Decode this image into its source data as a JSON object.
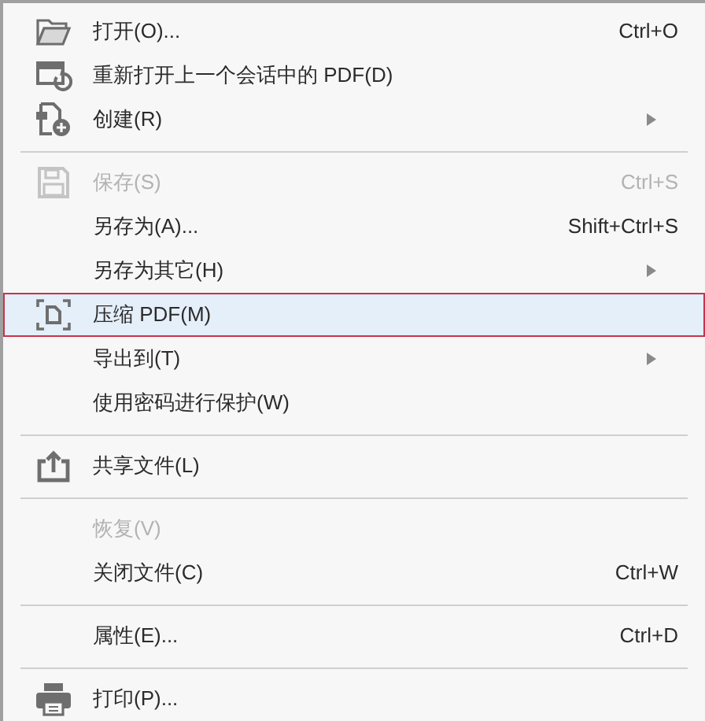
{
  "menu": [
    {
      "kind": "folder",
      "label": "打开(O)...",
      "shortcut": "Ctrl+O",
      "submenu": false,
      "disabled": false,
      "selected": false
    },
    {
      "kind": "reopen",
      "label": "重新打开上一个会话中的 PDF(D)",
      "submenu": false,
      "disabled": false,
      "selected": false
    },
    {
      "kind": "create",
      "label": "创建(R)",
      "submenu": true,
      "disabled": false,
      "selected": false
    },
    {
      "kind": "separator"
    },
    {
      "kind": "save",
      "label": "保存(S)",
      "shortcut": "Ctrl+S",
      "submenu": false,
      "disabled": true,
      "selected": false
    },
    {
      "kind": "plain",
      "label": "另存为(A)...",
      "shortcut": "Shift+Ctrl+S",
      "submenu": false,
      "disabled": false,
      "selected": false
    },
    {
      "kind": "plain",
      "label": "另存为其它(H)",
      "submenu": true,
      "disabled": false,
      "selected": false
    },
    {
      "kind": "compress",
      "label": "压缩 PDF(M)",
      "submenu": false,
      "disabled": false,
      "selected": true
    },
    {
      "kind": "plain",
      "label": "导出到(T)",
      "submenu": true,
      "disabled": false,
      "selected": false
    },
    {
      "kind": "plain",
      "label": "使用密码进行保护(W)",
      "submenu": false,
      "disabled": false,
      "selected": false
    },
    {
      "kind": "separator"
    },
    {
      "kind": "share",
      "label": "共享文件(L)",
      "submenu": false,
      "disabled": false,
      "selected": false
    },
    {
      "kind": "separator"
    },
    {
      "kind": "plain",
      "label": "恢复(V)",
      "submenu": false,
      "disabled": true,
      "selected": false
    },
    {
      "kind": "plain",
      "label": "关闭文件(C)",
      "shortcut": "Ctrl+W",
      "submenu": false,
      "disabled": false,
      "selected": false
    },
    {
      "kind": "separator"
    },
    {
      "kind": "plain",
      "label": "属性(E)...",
      "shortcut": "Ctrl+D",
      "submenu": false,
      "disabled": false,
      "selected": false
    },
    {
      "kind": "separator"
    },
    {
      "kind": "print",
      "label": "打印(P)...",
      "submenu": false,
      "disabled": false,
      "selected": false
    }
  ]
}
